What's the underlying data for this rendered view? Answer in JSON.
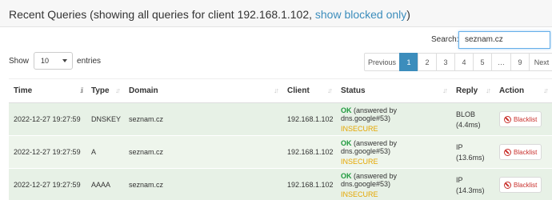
{
  "header": {
    "title_prefix": "Recent Queries (showing all queries for client 192.168.1.102, ",
    "title_link": "show blocked only",
    "title_suffix": ")"
  },
  "search": {
    "label": "Search:",
    "value": "seznam.cz"
  },
  "length": {
    "show_label": "Show",
    "selected": "10",
    "entries_label": "entries"
  },
  "pagination": {
    "previous": "Previous",
    "pages": [
      "1",
      "2",
      "3",
      "4",
      "5",
      "…",
      "9"
    ],
    "active_page": "1",
    "next": "Next"
  },
  "table": {
    "columns": [
      "Time",
      "Type",
      "Domain",
      "Client",
      "Status",
      "Reply",
      "Action"
    ],
    "rows": [
      {
        "time": "2022-12-27 19:27:59",
        "type": "DNSKEY",
        "domain": "seznam.cz",
        "client": "192.168.1.102",
        "status_ok": "OK",
        "status_detail": "(answered by dns.google#53)",
        "dnssec": "INSECURE",
        "reply_type": "BLOB",
        "reply_time": "(4.4ms)",
        "action": "Blacklist"
      },
      {
        "time": "2022-12-27 19:27:59",
        "type": "A",
        "domain": "seznam.cz",
        "client": "192.168.1.102",
        "status_ok": "OK",
        "status_detail": "(answered by dns.google#53)",
        "dnssec": "INSECURE",
        "reply_type": "IP",
        "reply_time": "(13.6ms)",
        "action": "Blacklist"
      },
      {
        "time": "2022-12-27 19:27:59",
        "type": "AAAA",
        "domain": "seznam.cz",
        "client": "192.168.1.102",
        "status_ok": "OK",
        "status_detail": "(answered by dns.google#53)",
        "dnssec": "INSECURE",
        "reply_type": "IP",
        "reply_time": "(14.3ms)",
        "action": "Blacklist"
      }
    ]
  },
  "colors": {
    "ok": "#1e9a3d",
    "insecure": "#e6a700",
    "link": "#3c8dbc",
    "row_bg": "#e7f1e6",
    "blacklist": "#c9302c"
  }
}
